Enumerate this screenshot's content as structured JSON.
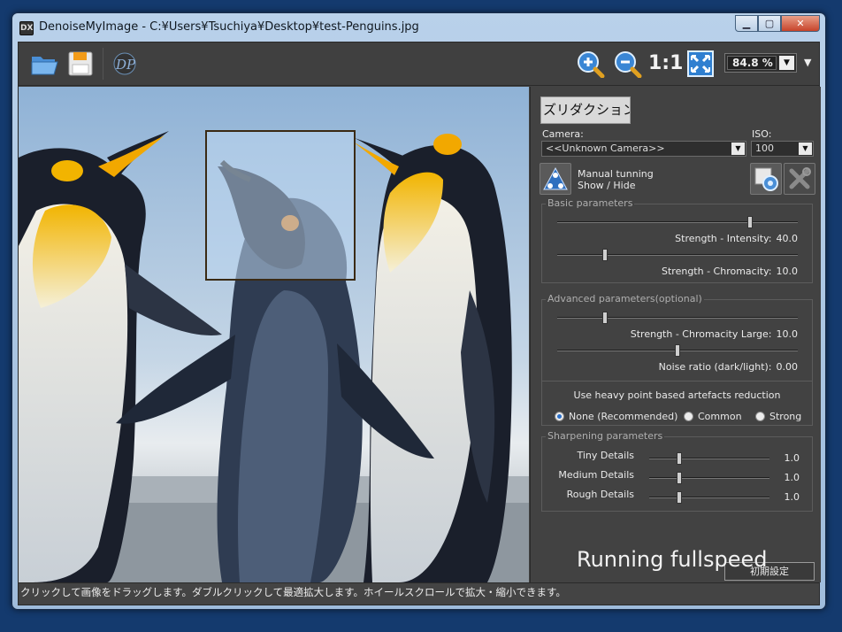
{
  "window": {
    "title": "DenoiseMyImage - C:¥Users¥Tsuchiya¥Desktop¥test-Penguins.jpg",
    "app_icon_text": "DX",
    "minimize_icon": "minimize-icon",
    "maximize_icon": "maximize-icon",
    "close_icon": "close-icon"
  },
  "toolbar": {
    "open_icon": "folder-open-icon",
    "save_icon": "floppy-save-icon",
    "logo_icon": "dp-logo-icon",
    "zoom_in_icon": "zoom-in-icon",
    "zoom_out_icon": "zoom-out-icon",
    "actual_size_label": "1:1",
    "fit_icon": "fit-screen-icon",
    "zoom_value": "84.8 %",
    "menu_icon": "menu-triangle-icon"
  },
  "panel": {
    "language_button": "ズリダクション",
    "camera_label": "Camera:",
    "camera_value": "<<Unknown Camera>>",
    "iso_label": "ISO:",
    "iso_value": "100",
    "manual_line1": "Manual tunning",
    "manual_line2": "Show / Hide",
    "basic": {
      "title": "Basic parameters",
      "params": [
        {
          "label": "Strength - Intensity:",
          "value": "40.0",
          "level": 0.8
        },
        {
          "label": "Strength - Chromacity:",
          "value": "10.0",
          "level": 0.2
        }
      ]
    },
    "advanced": {
      "title": "Advanced parameters(optional)",
      "params": [
        {
          "label": "Strength - Chromacity Large:",
          "value": "10.0",
          "level": 0.2
        },
        {
          "label": "Noise ratio (dark/light):",
          "value": "0.00",
          "level": 0.5
        }
      ],
      "artefacts_label": "Use heavy point based artefacts reduction",
      "options": [
        {
          "label": "None (Recommended)",
          "selected": true
        },
        {
          "label": "Common",
          "selected": false
        },
        {
          "label": "Strong",
          "selected": false
        }
      ]
    },
    "sharpening": {
      "title": "Sharpening parameters",
      "params": [
        {
          "label": "Tiny Details",
          "value": "1.0",
          "level": 0.25
        },
        {
          "label": "Medium Details",
          "value": "1.0",
          "level": 0.25
        },
        {
          "label": "Rough Details",
          "value": "1.0",
          "level": 0.25
        }
      ]
    },
    "reset_button": "初期設定",
    "running_text": "Running fullspeed"
  },
  "status": {
    "text": "クリックして画像をドラッグします。ダブルクリックして最適拡大します。ホイールスクロールで拡大・縮小できます。"
  },
  "colors": {
    "panel_bg": "#424242",
    "sky": "#aac4df",
    "penguin_yellow": "#f2b400",
    "penguin_dark": "#1a1f2b"
  }
}
